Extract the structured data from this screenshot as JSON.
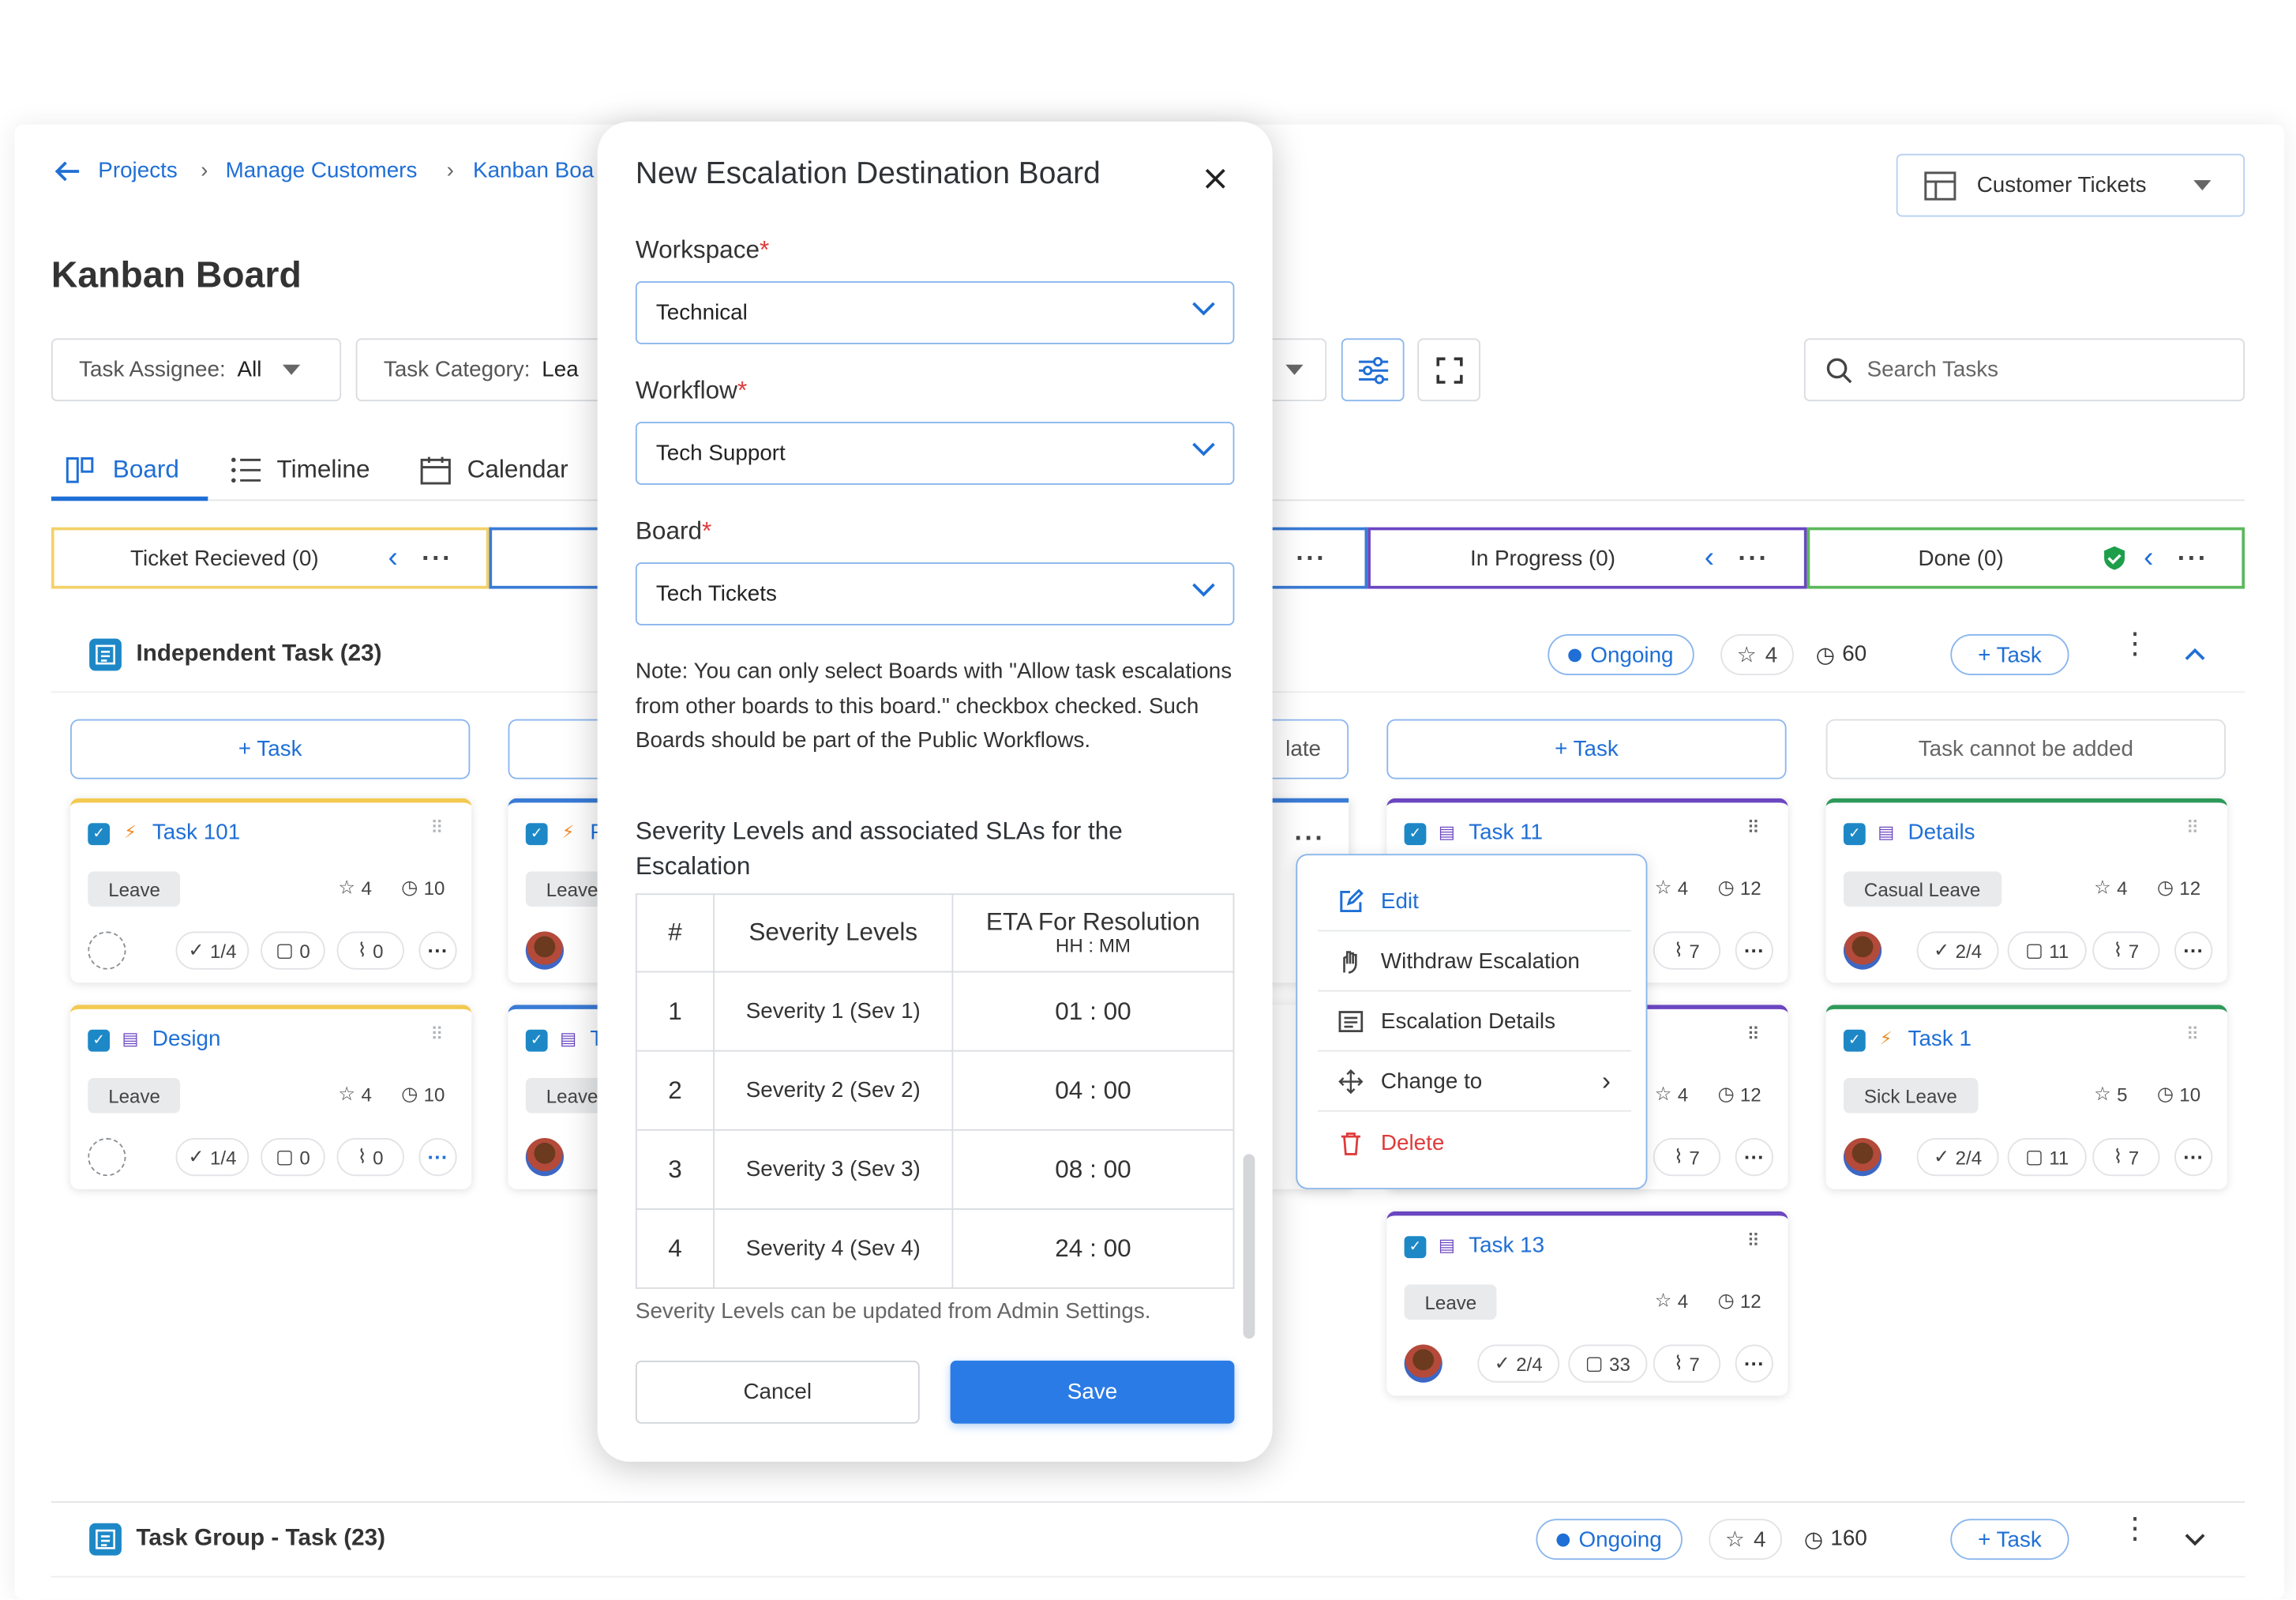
{
  "breadcrumb": {
    "projects": "Projects",
    "manage_customers": "Manage Customers",
    "kanban": "Kanban Boa"
  },
  "page_title": "Kanban Board",
  "board_selector": {
    "label": "Customer Tickets"
  },
  "filters": {
    "assignee_label": "Task Assignee:",
    "assignee_value": "All",
    "category_label": "Task Category:",
    "category_value": "Lea"
  },
  "search": {
    "placeholder": "Search Tasks"
  },
  "tabs": [
    {
      "label": "Board"
    },
    {
      "label": "Timeline"
    },
    {
      "label": "Calendar"
    }
  ],
  "columns": [
    {
      "label": "Ticket Recieved (0)"
    },
    {
      "label": "In Progress (0)"
    },
    {
      "label": "Done (0)"
    }
  ],
  "groups": {
    "independent": {
      "title": "Independent Task (23)",
      "status": "Ongoing",
      "stars": "4",
      "time": "60",
      "add": "+ Task"
    },
    "task_group": {
      "title": "Task Group - Task (23)",
      "status": "Ongoing",
      "stars": "4",
      "time": "160",
      "add": "+ Task"
    }
  },
  "add_buttons": {
    "col1": "+ Task",
    "col3_partial": "late",
    "col4": "+ Task",
    "col5": "Task cannot be added"
  },
  "cards": [
    {
      "title": "Task 101",
      "tag": "Leave",
      "stars": "4",
      "time": "10",
      "checks": "1/4",
      "comments": "0",
      "attachments": "0"
    },
    {
      "title": "Design",
      "tag": "Leave",
      "stars": "4",
      "time": "10",
      "checks": "1/4",
      "comments": "0",
      "attachments": "0"
    },
    {
      "title": "P",
      "tag": "Leave"
    },
    {
      "title": "T",
      "tag": "Leave"
    },
    {
      "title": "Task 11",
      "stars": "4",
      "time": "12",
      "attachments": "7"
    },
    {
      "title": "",
      "stars": "4",
      "time": "12",
      "attachments": "7"
    },
    {
      "title": "Task 13",
      "tag": "Leave",
      "stars": "4",
      "time": "12",
      "checks": "2/4",
      "comments": "33",
      "attachments": "7"
    },
    {
      "title": "Details",
      "tag": "Casual Leave",
      "stars": "4",
      "time": "12",
      "checks": "2/4",
      "comments": "11",
      "attachments": "7"
    },
    {
      "title": "Task 1",
      "tag": "Sick Leave",
      "stars": "5",
      "time": "10",
      "checks": "2/4",
      "comments": "11",
      "attachments": "7"
    }
  ],
  "context_menu": {
    "edit": "Edit",
    "withdraw": "Withdraw Escalation",
    "details": "Escalation Details",
    "change_to": "Change to",
    "delete": "Delete"
  },
  "modal": {
    "title": "New Escalation Destination Board",
    "workspace_label": "Workspace",
    "workspace_value": "Technical",
    "workflow_label": "Workflow",
    "workflow_value": "Tech Support",
    "board_label": "Board",
    "board_value": "Tech Tickets",
    "required_mark": "*",
    "note": "Note: You can only select Boards with \"Allow task escalations from other boards to this board.\" checkbox checked. Such Boards should be part of the Public Workflows.",
    "sla_heading": "Severity Levels and associated SLAs for the Escalation",
    "table_headers": {
      "num": "#",
      "level": "Severity Levels",
      "eta": "ETA For Resolution",
      "eta_sub": "HH : MM"
    },
    "rows": [
      {
        "num": "1",
        "level": "Severity 1 (Sev 1)",
        "eta": "01 : 00"
      },
      {
        "num": "2",
        "level": "Severity 2 (Sev 2)",
        "eta": "04 : 00"
      },
      {
        "num": "3",
        "level": "Severity 3 (Sev 3)",
        "eta": "08 : 00"
      },
      {
        "num": "4",
        "level": "Severity 4 (Sev 4)",
        "eta": "24 : 00"
      }
    ],
    "footnote": "Severity Levels can be updated from Admin Settings.",
    "cancel": "Cancel",
    "save": "Save"
  },
  "colors": {
    "accent": "#1f6fd6",
    "save": "#2b7be6",
    "delete": "#e03a3a",
    "col_ticket": "#f3c94f",
    "col_inprogress": "#6b46c1",
    "col_done": "#5cb85c",
    "col_blue": "#3a7bd5"
  }
}
